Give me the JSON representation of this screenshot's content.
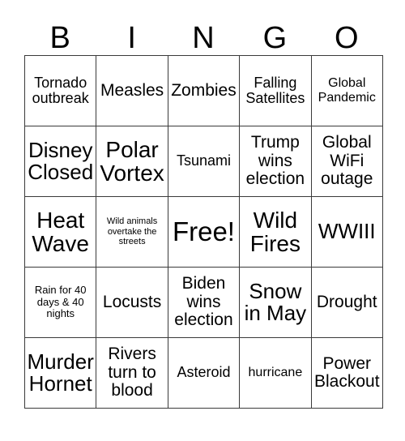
{
  "card": {
    "header_letters": [
      "B",
      "I",
      "N",
      "G",
      "O"
    ],
    "rows": [
      [
        {
          "text": "Tornado outbreak",
          "size": "s-md"
        },
        {
          "text": "Measles",
          "size": "s-lg"
        },
        {
          "text": "Zombies",
          "size": "s-lg"
        },
        {
          "text": "Falling Satellites",
          "size": "s-md"
        },
        {
          "text": "Global Pandemic",
          "size": "s-sm"
        }
      ],
      [
        {
          "text": "Disney Closed",
          "size": "s-xl"
        },
        {
          "text": "Polar Vortex",
          "size": "s-2xl"
        },
        {
          "text": "Tsunami",
          "size": "s-md"
        },
        {
          "text": "Trump wins election",
          "size": "s-lg"
        },
        {
          "text": "Global WiFi outage",
          "size": "s-lg"
        }
      ],
      [
        {
          "text": "Heat Wave",
          "size": "s-2xl"
        },
        {
          "text": "Wild animals overtake the streets",
          "size": "s-xxs"
        },
        {
          "text": "Free!",
          "size": "s-3xl"
        },
        {
          "text": "Wild Fires",
          "size": "s-2xl"
        },
        {
          "text": "WWIII",
          "size": "s-xl"
        }
      ],
      [
        {
          "text": "Rain for 40 days & 40 nights",
          "size": "s-xs"
        },
        {
          "text": "Locusts",
          "size": "s-lg"
        },
        {
          "text": "Biden wins election",
          "size": "s-lg"
        },
        {
          "text": "Snow in May",
          "size": "s-xl"
        },
        {
          "text": "Drought",
          "size": "s-lg"
        }
      ],
      [
        {
          "text": "Murder Hornet",
          "size": "s-xl"
        },
        {
          "text": "Rivers turn to blood",
          "size": "s-lg"
        },
        {
          "text": "Asteroid",
          "size": "s-md"
        },
        {
          "text": "hurricane",
          "size": "s-sm"
        },
        {
          "text": "Power Blackout",
          "size": "s-lg"
        }
      ]
    ]
  },
  "colors": {
    "background": "#ffffff",
    "text": "#000000",
    "grid_line": "#3a3a3a",
    "outer_border": "#5a5a5a"
  }
}
